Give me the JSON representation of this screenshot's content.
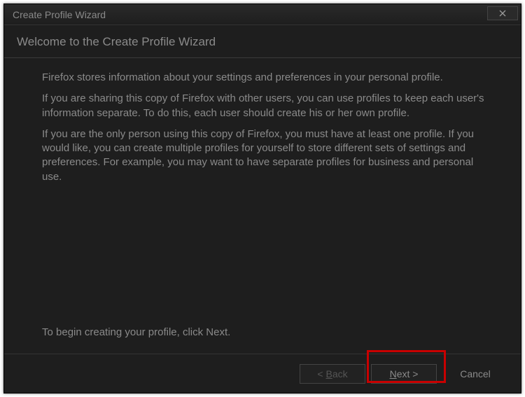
{
  "window": {
    "title": "Create Profile Wizard"
  },
  "heading": "Welcome to the Create Profile Wizard",
  "paragraphs": {
    "p1": "Firefox stores information about your settings and preferences in your personal profile.",
    "p2": "If you are sharing this copy of Firefox with other users, you can use profiles to keep each user's information separate. To do this, each user should create his or her own profile.",
    "p3": "If you are the only person using this copy of Firefox, you must have at least one profile. If you would like, you can create multiple profiles for yourself to store different sets of settings and preferences. For example, you may want to have separate profiles for business and personal use.",
    "begin": "To begin creating your profile, click Next."
  },
  "buttons": {
    "back_prefix": "< ",
    "back_mnemonic": "B",
    "back_rest": "ack",
    "next_mnemonic": "N",
    "next_rest": "ext >",
    "cancel": "Cancel"
  }
}
